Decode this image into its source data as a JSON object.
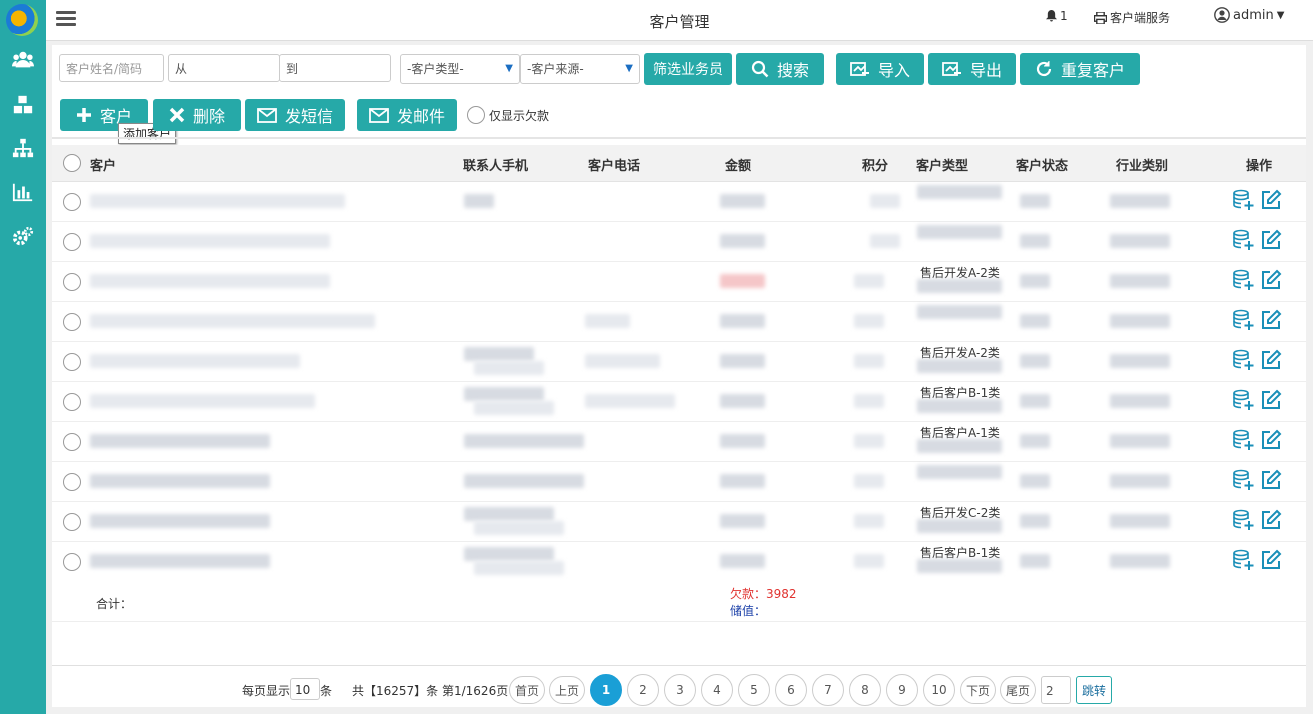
{
  "sidebar": {
    "logo": "app-logo",
    "items": [
      {
        "name": "users-icon"
      },
      {
        "name": "cubes-icon"
      },
      {
        "name": "org-chart-icon"
      },
      {
        "name": "bar-chart-icon"
      },
      {
        "name": "cogs-icon"
      }
    ]
  },
  "header": {
    "title": "客户管理",
    "notifications_count": "1",
    "client_service": "客户端服务",
    "user": "admin"
  },
  "filters": {
    "name_placeholder": "客户姓名/简码",
    "from_label": "从",
    "to_label": "到",
    "type_select": "-客户类型-",
    "source_select": "-客户来源-",
    "salesman_button": "筛选业务员",
    "search_button": "搜索",
    "import_button": "导入",
    "export_button": "导出",
    "duplicate_button": "重复客户"
  },
  "actions": {
    "add_button": "客户",
    "add_tooltip": "添加客户",
    "delete_button": "删除",
    "sms_button": "发短信",
    "email_button": "发邮件",
    "only_debt_label": "仅显示欠款"
  },
  "table": {
    "columns": [
      "客户",
      "联系人手机",
      "客户电话",
      "金额",
      "积分",
      "客户类型",
      "客户状态",
      "行业类别",
      "操作"
    ],
    "rows": [
      {
        "customer_type": ""
      },
      {
        "customer_type": ""
      },
      {
        "customer_type": "售后开发A-2类"
      },
      {
        "customer_type": ""
      },
      {
        "customer_type": "售后开发A-2类"
      },
      {
        "customer_type": "售后客户B-1类"
      },
      {
        "customer_type": "售后客户A-1类"
      },
      {
        "customer_type": ""
      },
      {
        "customer_type": "售后开发C-2类"
      },
      {
        "customer_type": "售后客户B-1类"
      }
    ],
    "summary": {
      "label": "合计：",
      "debt": "欠款：3982",
      "stored_value": "储值："
    }
  },
  "pagination": {
    "per_page_prefix": "每页显示",
    "per_page_value": "10",
    "per_page_suffix": "条",
    "total_text": "共【16257】条 第1/1626页",
    "first": "首页",
    "prev": "上页",
    "pages": [
      "1",
      "2",
      "3",
      "4",
      "5",
      "6",
      "7",
      "8",
      "9",
      "10"
    ],
    "current_page": "1",
    "next": "下页",
    "last": "尾页",
    "jump_value": "2",
    "jump": "跳转"
  },
  "colors": {
    "accent": "#26a9a8",
    "active_page": "#1a9fd6",
    "debt_red": "#e0322f",
    "stored_blue": "#1a3fa8"
  }
}
